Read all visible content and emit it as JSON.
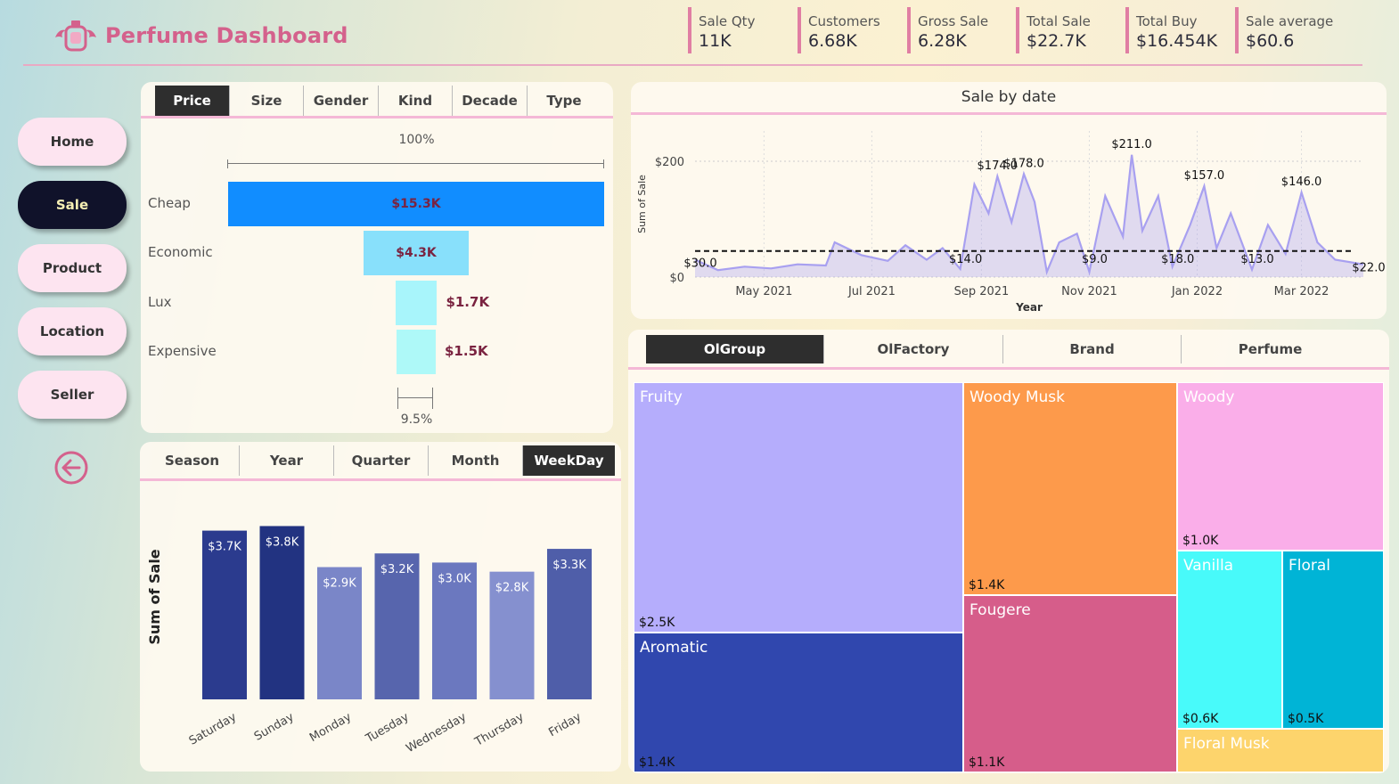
{
  "header": {
    "title": "Perfume Dashboard",
    "kpis": [
      {
        "label": "Sale Qty",
        "value": "11K"
      },
      {
        "label": "Customers",
        "value": "6.68K"
      },
      {
        "label": "Gross Sale",
        "value": "6.28K"
      },
      {
        "label": "Total Sale",
        "value": "$22.7K"
      },
      {
        "label": "Total Buy",
        "value": "$16.454K"
      },
      {
        "label": "Sale average",
        "value": "$60.6"
      }
    ]
  },
  "nav": {
    "home": "Home",
    "sale": "Sale",
    "product": "Product",
    "location": "Location",
    "seller": "Seller",
    "active": "Sale"
  },
  "colors": {
    "accent": "#e07ea3",
    "nav_active": "#10122a",
    "nav_inactive": "#fde4f0"
  },
  "funnel": {
    "tabs": [
      "Price",
      "Size",
      "Gender",
      "Kind",
      "Decade",
      "Type"
    ],
    "active_tab": "Price",
    "top_label": "100%",
    "bottom_label": "9.5%"
  },
  "weekday": {
    "tabs": [
      "Season",
      "Year",
      "Quarter",
      "Month",
      "WeekDay"
    ],
    "active_tab": "WeekDay"
  },
  "line_panel": {
    "title": "Sale by date"
  },
  "treemap_panel": {
    "tabs": [
      "OlGroup",
      "OlFactory",
      "Brand",
      "Perfume"
    ],
    "active_tab": "OlGroup"
  },
  "chart_data": [
    {
      "type": "bar",
      "orientation": "horizontal-funnel",
      "categories": [
        "Cheap",
        "Economic",
        "Lux",
        "Expensive"
      ],
      "values": [
        15.3,
        4.3,
        1.7,
        1.5
      ],
      "labels": [
        "$15.3K",
        "$4.3K",
        "$1.7K",
        "$1.5K"
      ],
      "colors": [
        "#118dff",
        "#88e0fb",
        "#a8f5fb",
        "#aef9f8"
      ]
    },
    {
      "type": "bar",
      "categories": [
        "Saturday",
        "Sunday",
        "Monday",
        "Tuesday",
        "Wednesday",
        "Thursday",
        "Friday"
      ],
      "values": [
        3.7,
        3.8,
        2.9,
        3.2,
        3.0,
        2.8,
        3.3
      ],
      "labels": [
        "$3.7K",
        "$3.8K",
        "$2.9K",
        "$3.2K",
        "$3.0K",
        "$2.8K",
        "$3.3K"
      ],
      "colors": [
        "#2b3b8e",
        "#223381",
        "#7a86c8",
        "#5765ad",
        "#6b78bf",
        "#8590cf",
        "#4f5ea9"
      ],
      "ylabel": "Sum of Sale",
      "ylim": [
        0,
        4.2
      ]
    },
    {
      "type": "area",
      "title": "Sale by date",
      "xlabel": "Year",
      "ylabel": "Sum of Sale",
      "y_ticks": [
        "$0",
        "$200"
      ],
      "x_ticks": [
        "May 2021",
        "Jul 2021",
        "Sep 2021",
        "Nov 2021",
        "Jan 2022",
        "Mar 2022"
      ],
      "ylim": [
        0,
        240
      ],
      "average": 45,
      "color": "#a8a0f0",
      "points": [
        [
          "2021-03-23",
          30
        ],
        [
          "2021-04-05",
          12
        ],
        [
          "2021-04-20",
          18
        ],
        [
          "2021-05-05",
          15
        ],
        [
          "2021-05-20",
          22
        ],
        [
          "2021-06-05",
          20
        ],
        [
          "2021-06-10",
          60
        ],
        [
          "2021-06-25",
          38
        ],
        [
          "2021-07-10",
          28
        ],
        [
          "2021-07-20",
          55
        ],
        [
          "2021-08-01",
          30
        ],
        [
          "2021-08-10",
          50
        ],
        [
          "2021-08-20",
          14
        ],
        [
          "2021-08-28",
          160
        ],
        [
          "2021-09-05",
          110
        ],
        [
          "2021-09-10",
          174
        ],
        [
          "2021-09-18",
          95
        ],
        [
          "2021-09-25",
          178
        ],
        [
          "2021-10-01",
          130
        ],
        [
          "2021-10-08",
          9
        ],
        [
          "2021-10-15",
          60
        ],
        [
          "2021-10-25",
          75
        ],
        [
          "2021-11-01",
          9
        ],
        [
          "2021-11-10",
          140
        ],
        [
          "2021-11-20",
          70
        ],
        [
          "2021-11-25",
          211
        ],
        [
          "2021-12-01",
          80
        ],
        [
          "2021-12-10",
          140
        ],
        [
          "2021-12-18",
          18
        ],
        [
          "2021-12-28",
          90
        ],
        [
          "2022-01-05",
          157
        ],
        [
          "2022-01-12",
          50
        ],
        [
          "2022-01-20",
          110
        ],
        [
          "2022-02-01",
          13
        ],
        [
          "2022-02-10",
          90
        ],
        [
          "2022-02-20",
          40
        ],
        [
          "2022-03-01",
          146
        ],
        [
          "2022-03-10",
          60
        ],
        [
          "2022-03-20",
          30
        ],
        [
          "2022-04-05",
          22
        ]
      ],
      "annotations": [
        {
          "date": "2021-03-23",
          "value": 30,
          "label": "$30.0"
        },
        {
          "date": "2021-08-20",
          "value": 14,
          "label": "$14.0"
        },
        {
          "date": "2021-09-10",
          "value": 174,
          "label": "$174.0"
        },
        {
          "date": "2021-09-25",
          "value": 178,
          "label": "$178.0"
        },
        {
          "date": "2021-11-01",
          "value": 9,
          "label": "$9.0"
        },
        {
          "date": "2021-11-25",
          "value": 211,
          "label": "$211.0"
        },
        {
          "date": "2021-12-18",
          "value": 18,
          "label": "$18.0"
        },
        {
          "date": "2022-01-05",
          "value": 157,
          "label": "$157.0"
        },
        {
          "date": "2022-02-01",
          "value": 13,
          "label": "$13.0"
        },
        {
          "date": "2022-03-01",
          "value": 146,
          "label": "$146.0"
        },
        {
          "date": "2022-04-05",
          "value": 22,
          "label": "$22.0"
        }
      ]
    },
    {
      "type": "treemap",
      "items": [
        {
          "name": "Fruity",
          "label": "$2.5K",
          "value": 2.5,
          "color": "#b5adfc"
        },
        {
          "name": "Aromatic",
          "label": "$1.4K",
          "value": 1.4,
          "color": "#3047ae"
        },
        {
          "name": "Woody Musk",
          "label": "$1.4K",
          "value": 1.4,
          "color": "#fd9a4b"
        },
        {
          "name": "Fougere",
          "label": "$1.1K",
          "value": 1.1,
          "color": "#d65d8a"
        },
        {
          "name": "Woody",
          "label": "$1.0K",
          "value": 1.0,
          "color": "#faaee9"
        },
        {
          "name": "Vanilla",
          "label": "$0.6K",
          "value": 0.6,
          "color": "#48fafa"
        },
        {
          "name": "Floral",
          "label": "$0.5K",
          "value": 0.5,
          "color": "#00b4d6"
        },
        {
          "name": "Floral Musk",
          "label": "",
          "value": 0.3,
          "color": "#fdd46c"
        }
      ]
    }
  ]
}
